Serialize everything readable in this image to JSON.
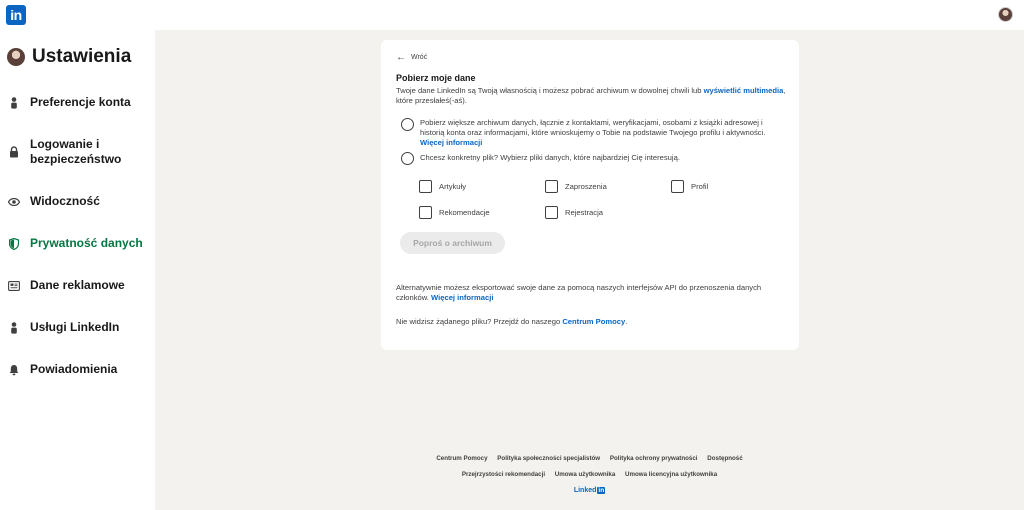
{
  "app": {
    "logo_text": "in"
  },
  "sidebar": {
    "title": "Ustawienia",
    "items": [
      {
        "label": "Preferencje konta",
        "icon": "person-icon"
      },
      {
        "label": "Logowanie i bezpieczeństwo",
        "icon": "lock-icon"
      },
      {
        "label": "Widoczność",
        "icon": "eye-icon"
      },
      {
        "label": "Prywatność danych",
        "icon": "shield-icon",
        "active": true
      },
      {
        "label": "Dane reklamowe",
        "icon": "newspaper-icon"
      },
      {
        "label": "Usługi LinkedIn",
        "icon": "person-icon"
      },
      {
        "label": "Powiadomienia",
        "icon": "bell-icon"
      }
    ]
  },
  "card": {
    "back_label": "Wróć",
    "title": "Pobierz moje dane",
    "intro_text": "Twoje dane LinkedIn są Twoją własnością i możesz pobrać archiwum w dowolnej chwili lub ",
    "intro_link": "wyświetlić multimedia",
    "intro_tail": ", które przesłałeś(-aś).",
    "option_full": "Pobierz większe archiwum danych, łącznie z kontaktami, weryfikacjami, osobami z książki adresowej i historią konta oraz informacjami, które wnioskujemy o Tobie na podstawie Twojego profilu i aktywności. ",
    "option_full_link": "Więcej informacji",
    "option_specific": "Chcesz konkretny plik? Wybierz pliki danych, które najbardziej Cię interesują.",
    "checkboxes": [
      "Artykuły",
      "Zaproszenia",
      "Profil",
      "Rekomendacje",
      "Rejestracja"
    ],
    "request_button": "Poproś o archiwum",
    "alt_text": "Alternatywnie możesz eksportować swoje dane za pomocą naszych interfejsów API do przenoszenia danych członków. ",
    "alt_link": "Więcej informacji",
    "help_text": "Nie widzisz żądanego pliku? Przejdź do naszego ",
    "help_link": "Centrum Pomocy",
    "help_tail": "."
  },
  "footer": {
    "row1": [
      "Centrum Pomocy",
      "Polityka społeczności specjalistów",
      "Polityka ochrony prywatności",
      "Dostępność"
    ],
    "row2": [
      "Przejrzystości rekomendacji",
      "Umowa użytkownika",
      "Umowa licencyjna użytkownika"
    ],
    "brand_text": "Linked",
    "brand_in": "in"
  }
}
